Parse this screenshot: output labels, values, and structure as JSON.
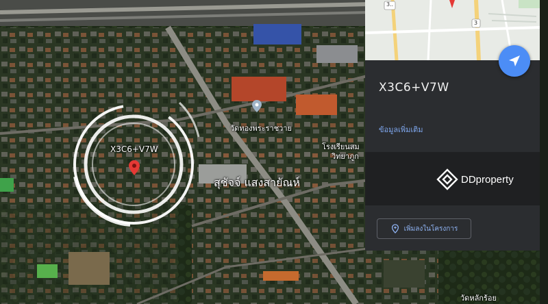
{
  "map": {
    "plus_code_label": "X3C6+V7W",
    "place_label_primary": "สุชัจจ์ แสงสายัณห์",
    "poi_labels": [
      {
        "text": "วัดทองพระราชวาย"
      },
      {
        "text": "โรงเรียนสม"
      },
      {
        "text": "วิทยาภูก"
      },
      {
        "text": "วัดหลักร้อย"
      }
    ]
  },
  "mini_map": {
    "road_shields": [
      "3..",
      "3"
    ]
  },
  "panel": {
    "plus_code_title": "X3C6+V7W",
    "more_info_link": "ข้อมูลเพิ่มเติม",
    "add_to_project_label": "เพิ่มลงในโครงการ"
  },
  "watermark": {
    "brand_name": "DDproperty"
  },
  "colors": {
    "accent_blue": "#4c8df6",
    "panel_bg": "#2b2d30",
    "pin_red": "#e53935",
    "link_blue": "#7fa8ef"
  },
  "icons": {
    "directions": "send-icon",
    "add": "pin-add-icon",
    "location": "map-pin-icon"
  }
}
